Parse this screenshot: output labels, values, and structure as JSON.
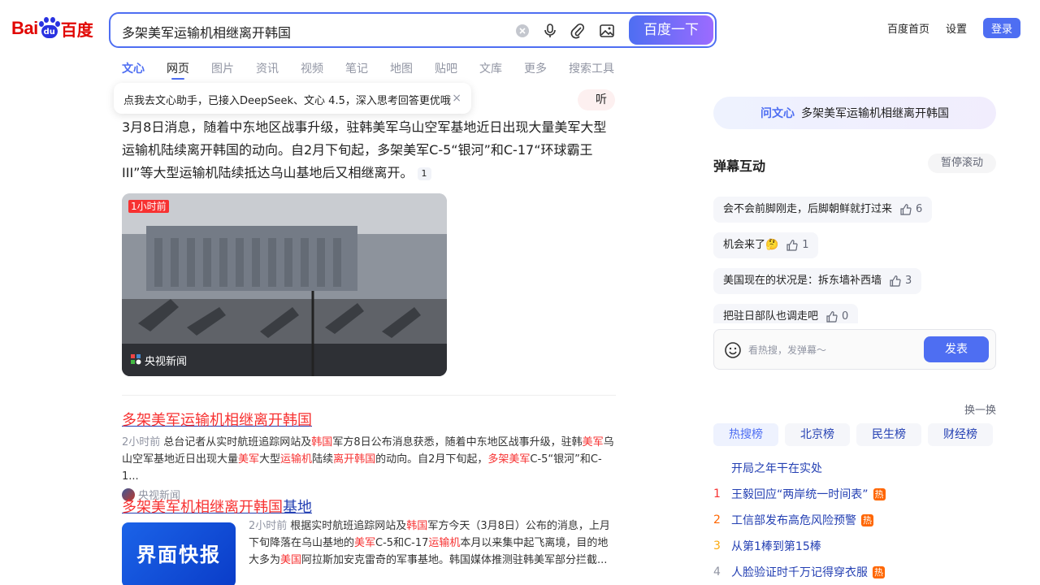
{
  "logo": {
    "part1": "Bai",
    "paw_text": "du",
    "part2": "百度"
  },
  "search": {
    "query": "多架美军运输机相继离开韩国",
    "button": "百度一下"
  },
  "top_nav": {
    "home": "百度首页",
    "settings": "设置",
    "login": "登录"
  },
  "tabs": [
    {
      "label": "文心"
    },
    {
      "label": "网页"
    },
    {
      "label": "图片"
    },
    {
      "label": "资讯"
    },
    {
      "label": "视频"
    },
    {
      "label": "笔记"
    },
    {
      "label": "地图"
    },
    {
      "label": "贴吧"
    },
    {
      "label": "文库"
    },
    {
      "label": "更多"
    },
    {
      "label": "搜索工具"
    }
  ],
  "tooltip": {
    "text": "点我去文心助手，已接入DeepSeek、文心 4.5，深入思考回答更优哦",
    "close": "×"
  },
  "listen": "听",
  "summary": {
    "text": "3月8日消息，随着中东地区战事升级，驻韩美军乌山空军基地近日出现大量美军大型运输机陆续离开韩国的动向。自2月下旬起，多架美军C-5“银河”和C-17“环球霸王III”等大型运输机陆续抵达乌山基地后又相继离开。",
    "cite": "1"
  },
  "news_image": {
    "time": "1小时前",
    "source": "央视新闻"
  },
  "result1": {
    "title": "多架美军运输机相继离开韩国",
    "time": "2小时前",
    "abstract_parts": [
      "总台记者从实时航班追踪网站及",
      "韩国",
      "军方8日公布消息获悉，随着中东地区战事升级，驻韩",
      "美军",
      "乌山空军基地近日出现大量",
      "美军",
      "大型",
      "运输机",
      "陆续",
      "离开韩国",
      "的动向。自2月下旬起，",
      "多架美军",
      "C-5“银河”和C-1..."
    ],
    "source": "央视新闻"
  },
  "result2": {
    "title_hl": "多架美军机相继离开韩国",
    "title_rest": "基地",
    "thumb_text": "界面快报",
    "time": "2小时前",
    "abstract_parts": [
      "根据实时航班追踪网站及",
      "韩国",
      "军方今天（3月8日）公布的消息，上月下旬降落在乌山基地的",
      "美军",
      "C-5和C-17",
      "运输机",
      "本月以来集中起飞离境，目的地大多为",
      "美国",
      "阿拉斯加安克雷奇的军事基地。韩国媒体推测驻韩美军部分拦截..."
    ]
  },
  "ask_wenxin": {
    "brand": "问文心",
    "text": "多架美军运输机相继离开韩国"
  },
  "danmu": {
    "title": "弹幕互动",
    "pause": "暂停滚动",
    "items": [
      {
        "text": "会不会前脚刚走，后脚朝鲜就打过来",
        "likes": "6"
      },
      {
        "text": "机会来了🤔",
        "likes": "1"
      },
      {
        "text": "美国现在的状况是：拆东墙补西墙",
        "likes": "3"
      },
      {
        "text": "把驻日部队也调走吧",
        "likes": "0"
      }
    ],
    "placeholder": "看热搜，发弹幕～",
    "send": "发表"
  },
  "hot": {
    "refresh": "换一换",
    "tabs": [
      "热搜榜",
      "北京榜",
      "民生榜",
      "财经榜"
    ],
    "items": [
      {
        "rank": "",
        "text": "开局之年干在实处",
        "tag": ""
      },
      {
        "rank": "1",
        "text": "王毅回应“两岸统一时间表”",
        "tag": "热"
      },
      {
        "rank": "2",
        "text": "工信部发布高危风险预警",
        "tag": "热"
      },
      {
        "rank": "3",
        "text": "从第1棒到第15棒",
        "tag": ""
      },
      {
        "rank": "4",
        "text": "人脸验证时千万记得穿衣服",
        "tag": "热"
      }
    ]
  },
  "colors": {
    "brand_blue": "#4e6ef2",
    "baidu_red": "#e10602",
    "highlight_red": "#f73131",
    "link_blue": "#2440b3",
    "hot_orange": "#ff6600"
  }
}
